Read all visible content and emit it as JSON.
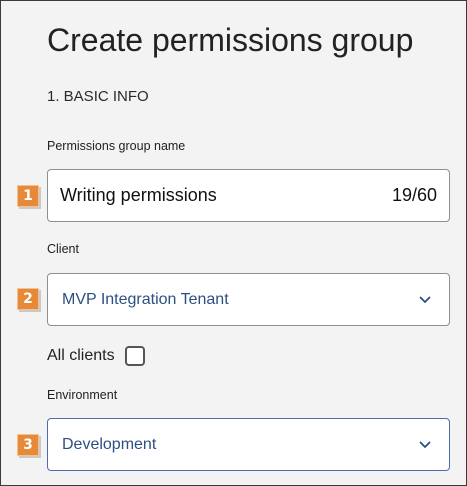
{
  "header": {
    "title": "Create permissions group"
  },
  "section": {
    "title": "1. BASIC INFO"
  },
  "fields": {
    "name": {
      "badge": "1",
      "label": "Permissions group name",
      "value": "Writing permissions",
      "counter": "19/60"
    },
    "client": {
      "badge": "2",
      "label": "Client",
      "selected": "MVP Integration Tenant",
      "icon": "chevron-down-icon"
    },
    "all_clients": {
      "label": "All clients",
      "checked": false
    },
    "environment": {
      "badge": "3",
      "label": "Environment",
      "selected": "Development",
      "icon": "chevron-down-icon"
    }
  },
  "colors": {
    "badge": "#e68a3a",
    "select_text": "#2d4f83",
    "active_border": "#4a6fa5",
    "background": "#f3f3f3"
  }
}
